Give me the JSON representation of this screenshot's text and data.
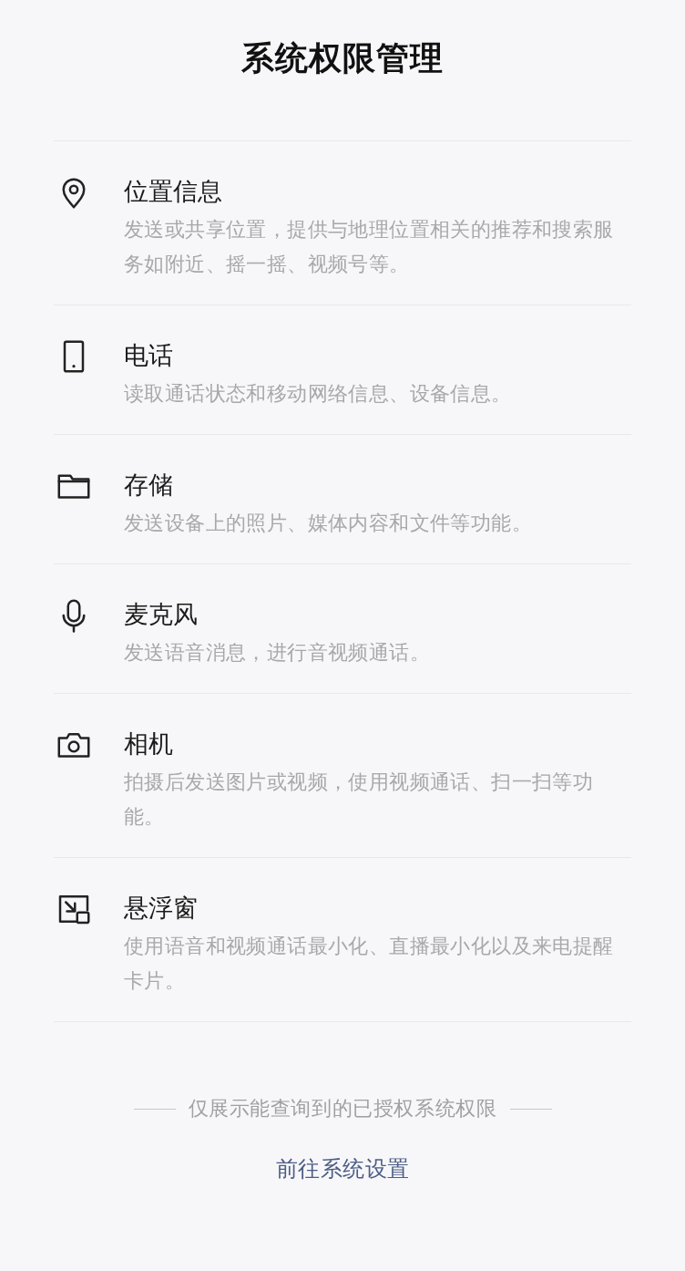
{
  "title": "系统权限管理",
  "permissions": [
    {
      "kind": "location",
      "name": "位置信息",
      "description": "发送或共享位置，提供与地理位置相关的推荐和搜索服务如附近、摇一摇、视频号等。"
    },
    {
      "kind": "phone",
      "name": "电话",
      "description": "读取通话状态和移动网络信息、设备信息。"
    },
    {
      "kind": "storage",
      "name": "存储",
      "description": "发送设备上的照片、媒体内容和文件等功能。"
    },
    {
      "kind": "microphone",
      "name": "麦克风",
      "description": "发送语音消息，进行音视频通话。"
    },
    {
      "kind": "camera",
      "name": "相机",
      "description": "拍摄后发送图片或视频，使用视频通话、扫一扫等功能。"
    },
    {
      "kind": "floating_window",
      "name": "悬浮窗",
      "description": "使用语音和视频通话最小化、直播最小化以及来电提醒卡片。"
    }
  ],
  "footer_note": "仅展示能查询到的已授权系统权限",
  "settings_link": "前往系统设置"
}
